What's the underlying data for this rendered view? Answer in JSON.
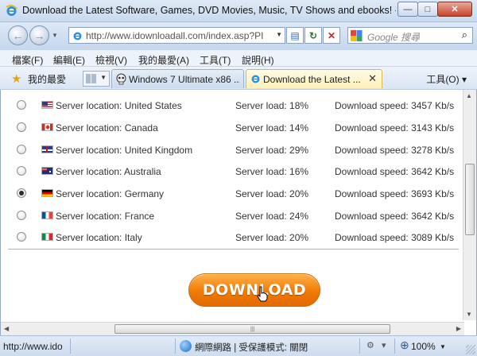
{
  "window": {
    "title": "Download the Latest Software, Games, DVD Movies, Music, TV Shows and ebooks! - i...",
    "buttons": {
      "minimize": "—",
      "maximize": "□",
      "close": "✕"
    }
  },
  "nav": {
    "back_icon": "back-arrow-icon",
    "forward_icon": "forward-arrow-icon",
    "address": "http://www.idownloadall.com/index.asp?PI",
    "search_placeholder": "Google 搜尋"
  },
  "menu": [
    "檔案(F)",
    "編輯(E)",
    "檢視(V)",
    "我的最愛(A)",
    "工具(T)",
    "說明(H)"
  ],
  "favorites": {
    "label": "我的最愛",
    "tools": "工具(O) ▾"
  },
  "tabs": [
    {
      "label": "Windows 7 Ultimate x86 ...",
      "active": false
    },
    {
      "label": "Download the Latest ...",
      "active": true
    }
  ],
  "servers": [
    {
      "flag": "us",
      "location": "Server location: United States",
      "load": "Server load: 18%",
      "speed": "Download speed: 3457 Kb/s",
      "selected": false
    },
    {
      "flag": "ca",
      "location": "Server location: Canada",
      "load": "Server load: 14%",
      "speed": "Download speed: 3143 Kb/s",
      "selected": false
    },
    {
      "flag": "uk",
      "location": "Server location: United Kingdom",
      "load": "Server load: 29%",
      "speed": "Download speed: 3278 Kb/s",
      "selected": false
    },
    {
      "flag": "au",
      "location": "Server location: Australia",
      "load": "Server load: 16%",
      "speed": "Download speed: 3642 Kb/s",
      "selected": false
    },
    {
      "flag": "de",
      "location": "Server location: Germany",
      "load": "Server load: 20%",
      "speed": "Download speed: 3693 Kb/s",
      "selected": true
    },
    {
      "flag": "fr",
      "location": "Server location: France",
      "load": "Server load: 24%",
      "speed": "Download speed: 3642 Kb/s",
      "selected": false
    },
    {
      "flag": "it",
      "location": "Server location: Italy",
      "load": "Server load: 20%",
      "speed": "Download speed: 3089 Kb/s",
      "selected": false
    }
  ],
  "download_button": "DOWNLOAD",
  "status": {
    "url": "http://www.ido",
    "zone": "網際網路 | 受保護模式: 關閉",
    "zoom": "100%"
  },
  "colors": {
    "accent_orange": "#f07a05",
    "chrome_blue": "#c9daef"
  }
}
